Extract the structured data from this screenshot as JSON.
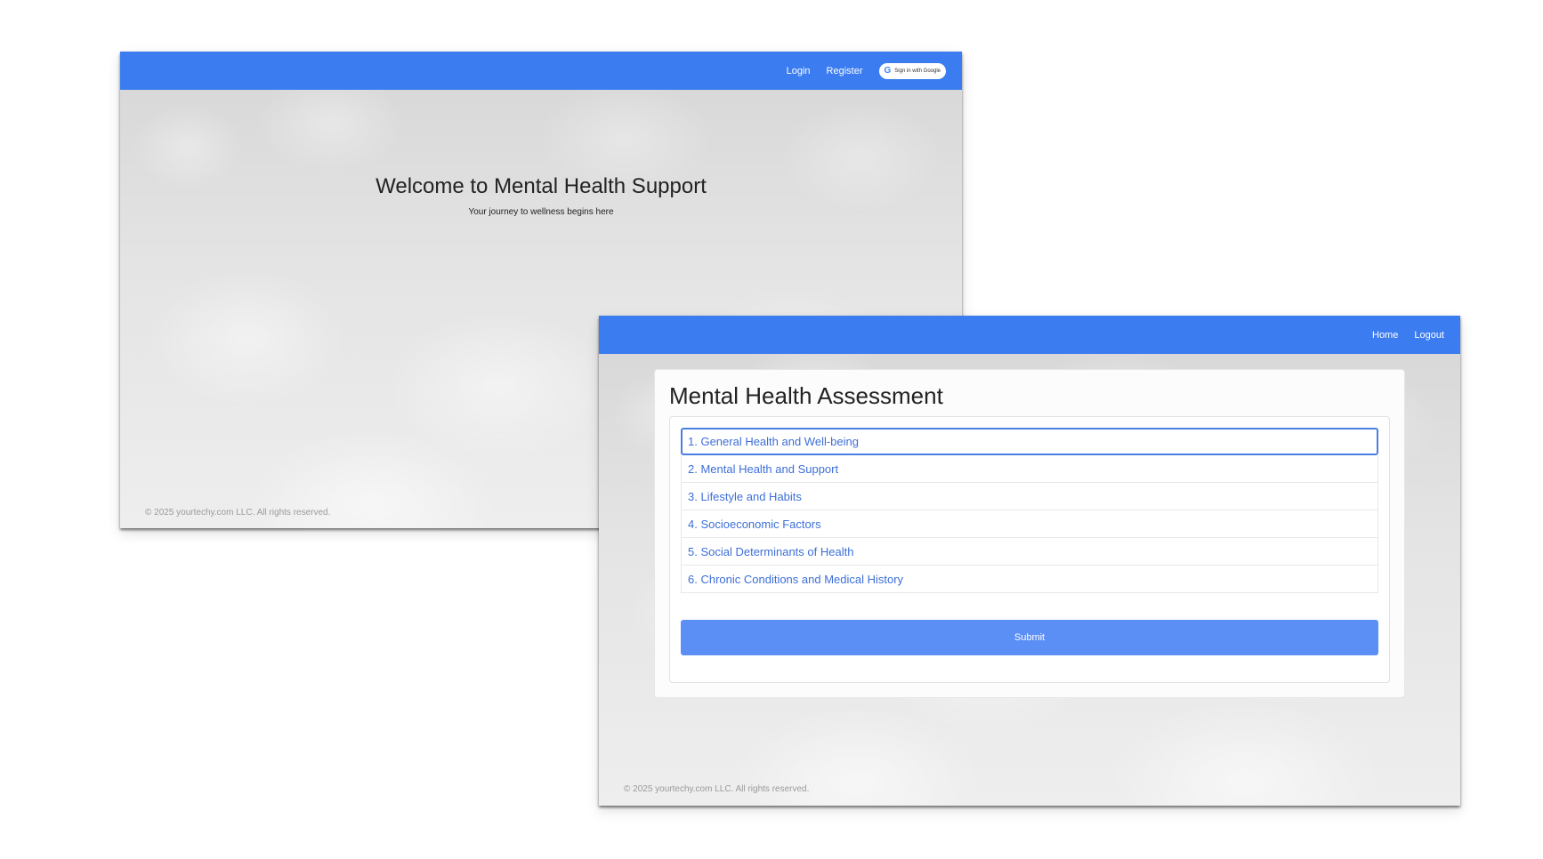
{
  "colors": {
    "navbar": "#3b7cf0",
    "link": "#3d6fd8",
    "submit": "#5b8ff5",
    "footer_text": "#9a9a9a"
  },
  "landing": {
    "nav": {
      "login": "Login",
      "register": "Register",
      "google_icon": "google-g-icon",
      "google_signin": "Sign in with Google"
    },
    "hero": {
      "title": "Welcome to Mental Health Support",
      "subtitle": "Your journey to wellness begins here"
    },
    "footer": "© 2025 yourtechy.com LLC. All rights reserved."
  },
  "assessment": {
    "nav": {
      "home": "Home",
      "logout": "Logout"
    },
    "title": "Mental Health Assessment",
    "sections": [
      "1. General Health and Well-being",
      "2. Mental Health and Support",
      "3. Lifestyle and Habits",
      "4. Socioeconomic Factors",
      "5. Social Determinants of Health",
      "6. Chronic Conditions and Medical History"
    ],
    "submit_label": "Submit",
    "footer": "© 2025 yourtechy.com LLC. All rights reserved."
  }
}
